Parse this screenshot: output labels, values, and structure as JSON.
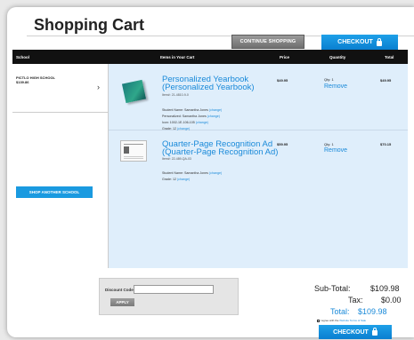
{
  "page": {
    "title": "Shopping Cart"
  },
  "buttons": {
    "continue_shopping": "CONTINUE SHOPPING",
    "checkout": "CHECKOUT",
    "shop_another_school": "SHOP ANOTHER SCHOOL",
    "apply": "APPLY",
    "checkout_bottom": "CHECKOUT"
  },
  "table_headers": {
    "school": "School",
    "items": "Items in Your Cart",
    "price": "Price",
    "quantity": "Quantity",
    "total": "Total"
  },
  "school": {
    "name": "PICTLO HIGH SCHOOL",
    "amount": "$139.86"
  },
  "items": [
    {
      "title_line1": "Personalized Yearbook",
      "title_line2": "(Personalized Yearbook)",
      "sku": "Item#: 21-4810-9-0",
      "details": [
        {
          "text": "Student Name: Samantha Jones",
          "change": "(change)"
        },
        {
          "text": "Personalized: Samantha Jones",
          "change": "(change)"
        },
        {
          "text": "Icon: 1002-1E-106-105",
          "change": "(change)"
        },
        {
          "text": "Grade: 12",
          "change": "(change)"
        }
      ],
      "price": "$49.95",
      "qty": "Qty: 1",
      "remove": "Remove",
      "total": "$49.95"
    },
    {
      "title_line1": "Quarter-Page Recognition Ad",
      "title_line2": "(Quarter-Page Recognition Ad)",
      "sku": "Item#: 22-489-QA-03",
      "details": [
        {
          "text": "Student Name: Samantha Jones",
          "change": "(change)"
        },
        {
          "text": "Grade: 12",
          "change": "(change)"
        }
      ],
      "price": "$59.95",
      "qty": "Qty: 1",
      "remove": "Remove",
      "total": "$70.15"
    }
  ],
  "discount": {
    "label": "Discount Code",
    "placeholder": ""
  },
  "summary": {
    "subtotal_label": "Sub-Total:",
    "subtotal_value": "$109.98",
    "tax_label": "Tax:",
    "tax_value": "$0.00",
    "total_label": "Total:",
    "total_value": "$109.98"
  },
  "terms": {
    "prefix": "I agree with the",
    "link": "Website Terms of Sale"
  },
  "colors": {
    "accent": "#1a9ae0",
    "link": "#1a8ad9",
    "header": "#111111",
    "items_bg": "#dfeefb"
  }
}
